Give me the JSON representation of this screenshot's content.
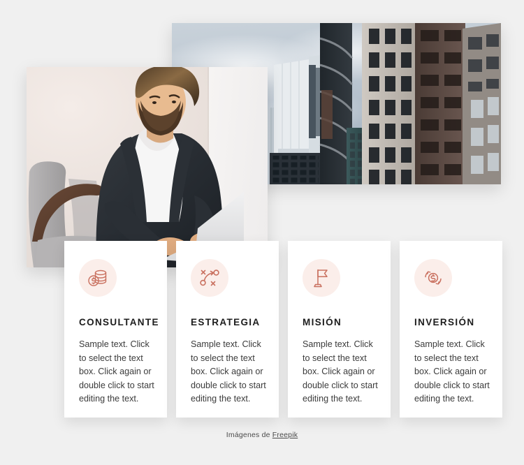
{
  "page": {
    "background_color": "#f0f0f0",
    "accent_color": "#c9705f",
    "icon_circle_color": "#fbeeea"
  },
  "images": [
    {
      "name": "city-skyline-photo",
      "alt": "Cloudy sky above modern office skyscrapers in a city"
    },
    {
      "name": "man-with-laptop-photo",
      "alt": "Bearded businessman in dark blazer typing on a laptop in an armchair"
    }
  ],
  "cards": [
    {
      "icon": "coins-stack-dollar-icon",
      "title": "CONSULTANTE",
      "text": "Sample text. Click to select the text box. Click again or double click to start editing the text."
    },
    {
      "icon": "strategy-xo-arrow-icon",
      "title": "ESTRATEGIA",
      "text": "Sample text. Click to select the text box. Click again or double click to start editing the text."
    },
    {
      "icon": "flag-icon",
      "title": "MISIÓN",
      "text": "Sample text. Click to select the text box. Click again or double click to start editing the text."
    },
    {
      "icon": "dollar-refresh-cycle-icon",
      "title": "INVERSIÓN",
      "text": "Sample text. Click to select the text box. Click again or double click to start editing the text."
    }
  ],
  "footer": {
    "prefix": "Imágenes de ",
    "link_label": "Freepik"
  }
}
